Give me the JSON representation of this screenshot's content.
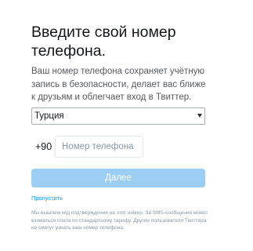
{
  "page": {
    "title": "Введите свой номер телефона.",
    "description": "Ваш номер телефона сохраняет учётную запись в безопасности, делает вас ближе к друзьям и облегчает вход в Твиттер."
  },
  "country_select": {
    "selected": "Турция"
  },
  "phone": {
    "country_code": "+90",
    "placeholder": "Номер телефона",
    "value": ""
  },
  "actions": {
    "next_label": "Далее",
    "skip_label": "Пропустить"
  },
  "disclaimer": "Мы вышлем код подтверждения на этот номер. За SMS-сообщения может взиматься плата по стандартному тарифу. Другие пользователи Твиттера не смогут узнать ваш номер телефона.",
  "colors": {
    "accent": "#1b95e0",
    "button_disabled": "#9ccdf3",
    "text_primary": "#14171a",
    "text_secondary": "#555a60",
    "text_muted": "#8899a6"
  }
}
